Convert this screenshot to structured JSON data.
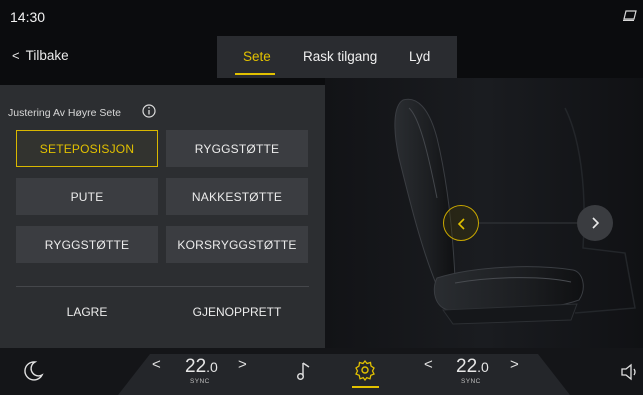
{
  "status": {
    "time": "14:30"
  },
  "nav": {
    "back_label": "Tilbake"
  },
  "tabs": [
    {
      "label": "Sete",
      "active": true
    },
    {
      "label": "Rask tilgang",
      "active": false
    },
    {
      "label": "Lyd",
      "active": false
    }
  ],
  "panel": {
    "title": "Justering Av Høyre Sete",
    "buttons": [
      {
        "label": "SETEPOSISJON",
        "active": true
      },
      {
        "label": "RYGGSTØTTE",
        "active": false
      },
      {
        "label": "PUTE",
        "active": false
      },
      {
        "label": "NAKKESTØTTE",
        "active": false
      },
      {
        "label": "RYGGSTØTTE",
        "active": false
      },
      {
        "label": "KORSRYGGSTØTTE",
        "active": false
      }
    ],
    "save_label": "LAGRE",
    "restore_label": "GJENOPPRETT"
  },
  "climate": {
    "left_temp": {
      "whole": "22",
      "decimal": ".0",
      "sync": "SYNC"
    },
    "right_temp": {
      "whole": "22",
      "decimal": ".0",
      "sync": "SYNC"
    }
  },
  "icons": [
    "device-icon",
    "info-icon",
    "chevron-left-icon",
    "chevron-right-icon",
    "moon-icon",
    "music-icon",
    "gear-icon",
    "speaker-icon"
  ],
  "colors": {
    "accent": "#e2c100",
    "panel": "#2c2e31",
    "button": "#3b3d41",
    "background": "#0b0c0e"
  }
}
